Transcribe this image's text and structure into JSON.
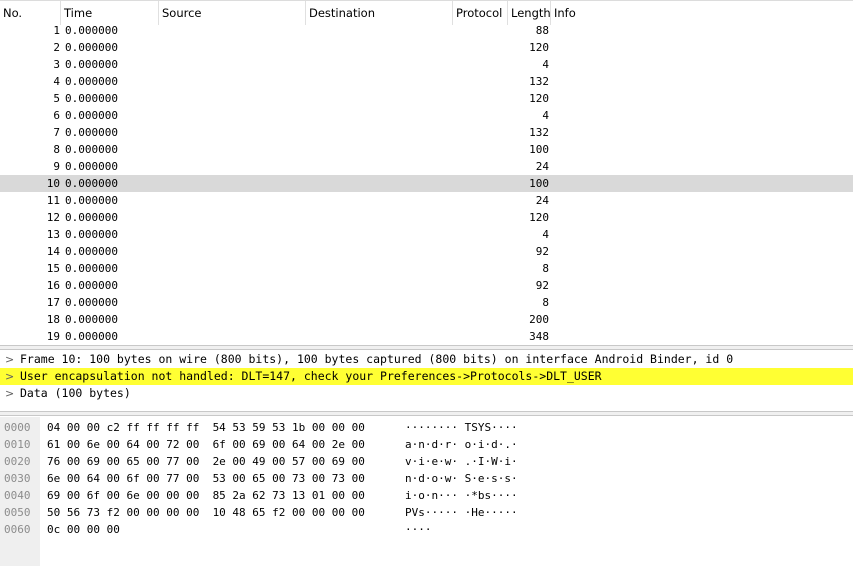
{
  "packet_list": {
    "columns": [
      "No.",
      "Time",
      "Source",
      "Destination",
      "Protocol",
      "Length",
      "Info"
    ],
    "selected_no": "10",
    "rows": [
      {
        "no": "1",
        "time": "0.000000",
        "len": "88"
      },
      {
        "no": "2",
        "time": "0.000000",
        "len": "120"
      },
      {
        "no": "3",
        "time": "0.000000",
        "len": "4"
      },
      {
        "no": "4",
        "time": "0.000000",
        "len": "132"
      },
      {
        "no": "5",
        "time": "0.000000",
        "len": "120"
      },
      {
        "no": "6",
        "time": "0.000000",
        "len": "4"
      },
      {
        "no": "7",
        "time": "0.000000",
        "len": "132"
      },
      {
        "no": "8",
        "time": "0.000000",
        "len": "100"
      },
      {
        "no": "9",
        "time": "0.000000",
        "len": "24"
      },
      {
        "no": "10",
        "time": "0.000000",
        "len": "100"
      },
      {
        "no": "11",
        "time": "0.000000",
        "len": "24"
      },
      {
        "no": "12",
        "time": "0.000000",
        "len": "120"
      },
      {
        "no": "13",
        "time": "0.000000",
        "len": "4"
      },
      {
        "no": "14",
        "time": "0.000000",
        "len": "92"
      },
      {
        "no": "15",
        "time": "0.000000",
        "len": "8"
      },
      {
        "no": "16",
        "time": "0.000000",
        "len": "92"
      },
      {
        "no": "17",
        "time": "0.000000",
        "len": "8"
      },
      {
        "no": "18",
        "time": "0.000000",
        "len": "200"
      },
      {
        "no": "19",
        "time": "0.000000",
        "len": "348"
      }
    ]
  },
  "details": {
    "chevron": ">",
    "items": [
      {
        "text": "Frame 10: 100 bytes on wire (800 bits), 100 bytes captured (800 bits) on interface Android Binder, id 0",
        "warning": false
      },
      {
        "text": "User encapsulation not handled: DLT=147, check your Preferences->Protocols->DLT_USER",
        "warning": true
      },
      {
        "text": "Data (100 bytes)",
        "warning": false
      }
    ],
    "warning_color": "#ffff33"
  },
  "bytes": {
    "rows": [
      {
        "offset": "0000",
        "hex": "04 00 00 c2 ff ff ff ff  54 53 59 53 1b 00 00 00",
        "ascii": "········ TSYS····"
      },
      {
        "offset": "0010",
        "hex": "61 00 6e 00 64 00 72 00  6f 00 69 00 64 00 2e 00",
        "ascii": "a·n·d·r· o·i·d·.·"
      },
      {
        "offset": "0020",
        "hex": "76 00 69 00 65 00 77 00  2e 00 49 00 57 00 69 00",
        "ascii": "v·i·e·w· .·I·W·i·"
      },
      {
        "offset": "0030",
        "hex": "6e 00 64 00 6f 00 77 00  53 00 65 00 73 00 73 00",
        "ascii": "n·d·o·w· S·e·s·s·"
      },
      {
        "offset": "0040",
        "hex": "69 00 6f 00 6e 00 00 00  85 2a 62 73 13 01 00 00",
        "ascii": "i·o·n··· ·*bs····"
      },
      {
        "offset": "0050",
        "hex": "50 56 73 f2 00 00 00 00  10 48 65 f2 00 00 00 00",
        "ascii": "PVs····· ·He·····"
      },
      {
        "offset": "0060",
        "hex": "0c 00 00 00",
        "ascii": "····"
      }
    ]
  }
}
